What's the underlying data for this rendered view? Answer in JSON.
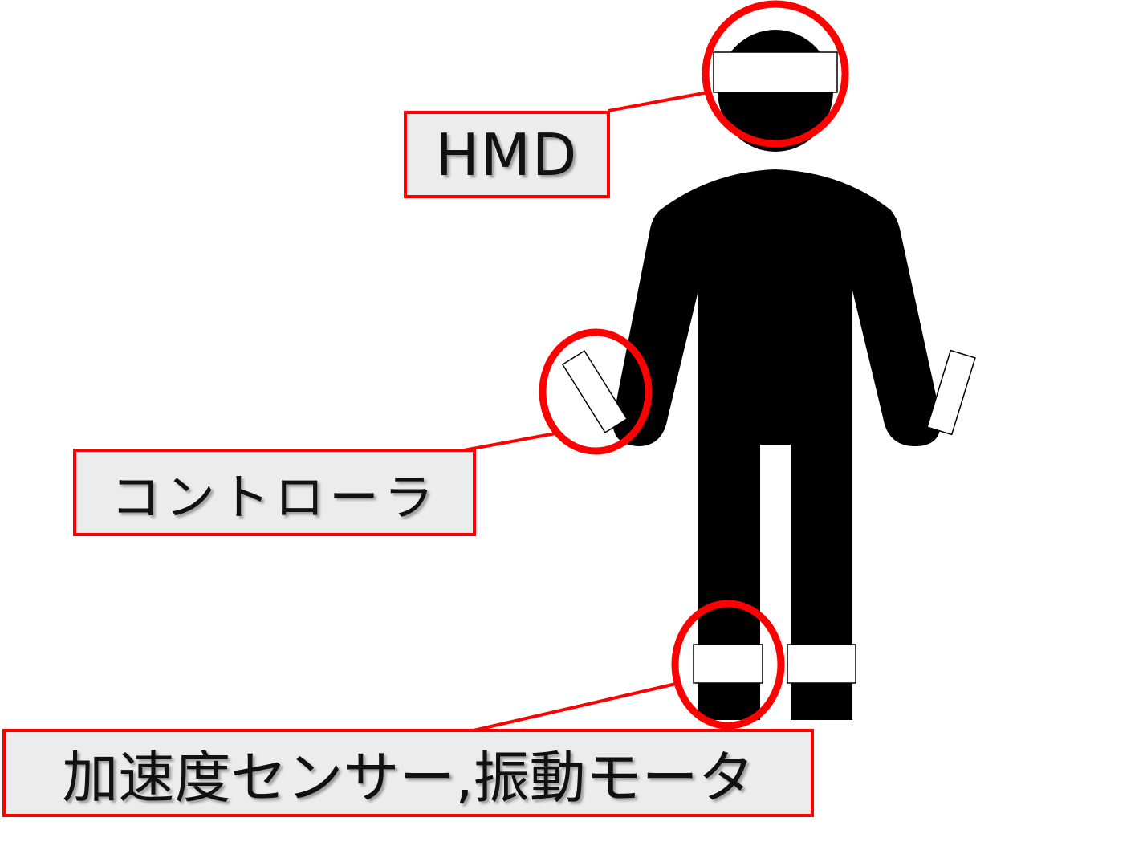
{
  "labels": {
    "hmd": "HMD",
    "controller": "コントローラ",
    "sensor_motor": "加速度センサー,振動モータ"
  },
  "colors": {
    "highlight": "#ff0000",
    "figure": "#000000",
    "label_bg": "#ececec"
  }
}
